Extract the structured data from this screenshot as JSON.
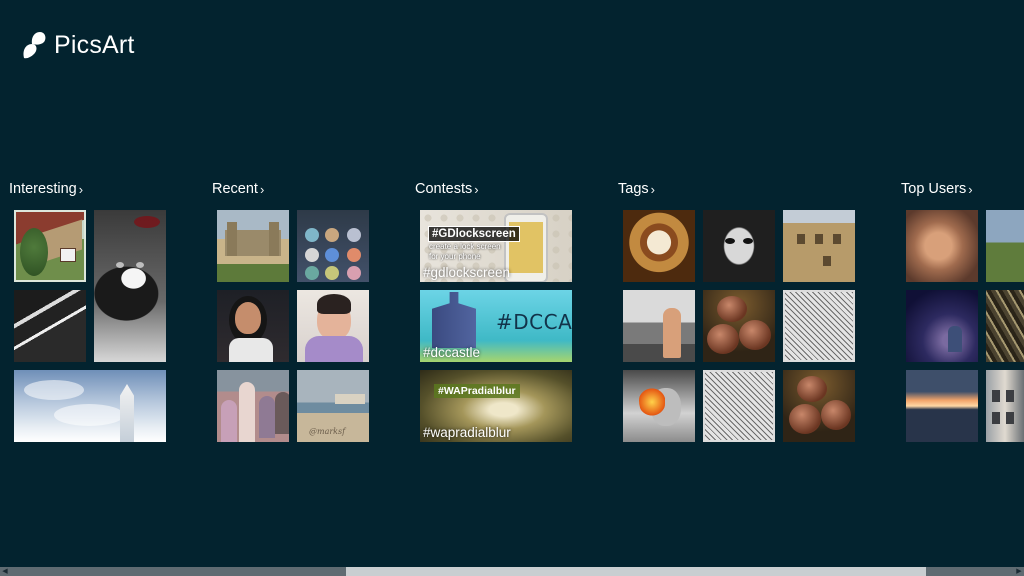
{
  "app": {
    "name": "PicsArt"
  },
  "sections": {
    "interesting": {
      "label": "Interesting",
      "chevron": "›"
    },
    "recent": {
      "label": "Recent",
      "chevron": "›"
    },
    "contests": {
      "label": "Contests",
      "chevron": "›"
    },
    "tags": {
      "label": "Tags",
      "chevron": "›"
    },
    "top_users": {
      "label": "Top Users",
      "chevron": "›"
    }
  },
  "contests": [
    {
      "tag_overlay": "#GDlockscreen",
      "subtitle_line1": "create a lock screen",
      "subtitle_line2": "for your phone",
      "hashtag": "#gdlockscreen"
    },
    {
      "tag_overlay": "#DCCASTLE",
      "hashtag": "#dccastle"
    },
    {
      "tag_overlay": "#WAPradialblur",
      "hashtag": "#wapradialblur"
    }
  ],
  "recent": {
    "beach_signature": "@marksf"
  },
  "colors": {
    "background": "#03232f",
    "text": "#ffffff",
    "scroll_thumb": "#c9ced1",
    "scroll_track": "#5f6b72"
  },
  "icons": {
    "logo": "picsart-logo-icon",
    "scroll_left": "scroll-left-arrow-icon",
    "scroll_right": "scroll-right-arrow-icon"
  },
  "scrollbar": {
    "thumb_start_fraction": 0.338,
    "thumb_length_fraction": 0.566
  }
}
